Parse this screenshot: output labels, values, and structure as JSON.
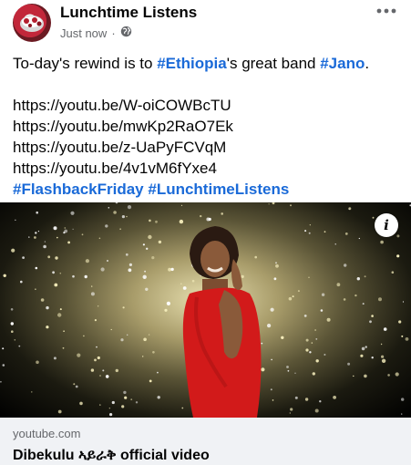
{
  "post": {
    "author": "Lunchtime Listens",
    "timestamp": "Just now",
    "separator": "·",
    "audience_icon": "globe-icon",
    "text": {
      "line1_a": "To-day's rewind is to ",
      "line1_tag1": "#Ethiopia",
      "line1_b": "'s great band ",
      "line1_tag2": "#Jano",
      "line1_c": ".",
      "links": [
        "https://youtu.be/W-oiCOWBcTU",
        "https://youtu.be/mwKp2RaO7Ek",
        "https://youtu.be/z-UaPyFCVqM",
        "https://youtu.be/4v1vM6fYxe4"
      ],
      "tag3": "#FlashbackFriday",
      "tag4": "#LunchtimeListens"
    }
  },
  "link_preview": {
    "domain": "youtube.com",
    "title": "Dibekulu ኣይራቅ official video",
    "info_label": "i"
  },
  "colors": {
    "hashtag": "#1a6ad8",
    "secondary_text": "#65676b",
    "card_bg": "#f0f2f5"
  }
}
